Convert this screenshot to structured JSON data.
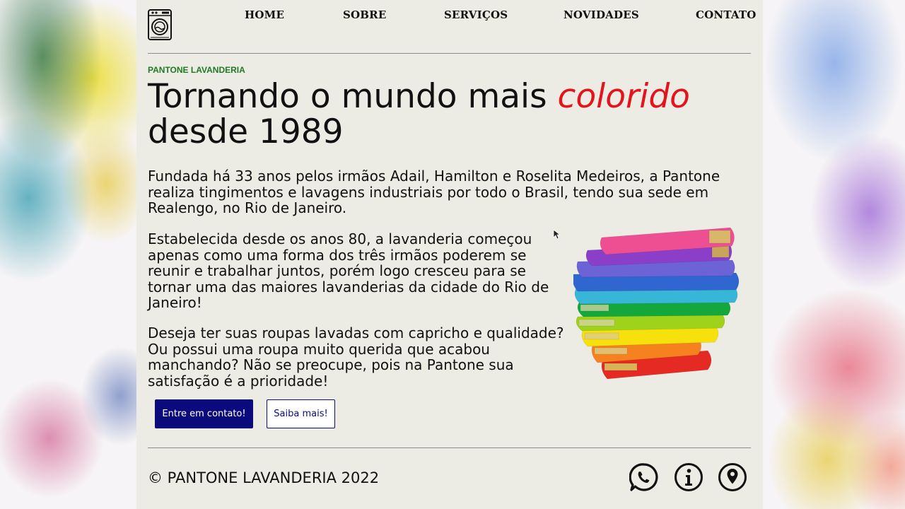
{
  "nav": {
    "home": "HOME",
    "about": "SOBRE",
    "services": "SERVIÇOS",
    "news": "NOVIDADES",
    "contact": "CONTATO"
  },
  "hero": {
    "eyebrow": "PANTONE LAVANDERIA",
    "headline_part1": "Tornando o mundo mais ",
    "headline_accent": "colorido",
    "headline_part2": "desde 1989",
    "paragraph1": "Fundada há 33 anos pelos irmãos Adail, Hamilton e Roselita Medeiros, a Pantone realiza tingimentos e lavagens industriais por todo o Brasil, tendo sua sede em Realengo, no Rio de Janeiro.",
    "paragraph2": "Estabelecida desde os anos 80, a lavanderia começou apenas como uma forma dos três irmãos poderem se reunir e trabalhar juntos, porém logo cresceu para se tornar uma das maiores lavanderias da cidade do Rio de Janeiro!",
    "paragraph3": "Deseja ter suas roupas lavadas com capricho e qualidade? Ou possui uma roupa muito querida que acabou manchando? Não se preocupe, pois na Pantone sua satisfação é a prioridade!",
    "cta_primary": "Entre em contato!",
    "cta_secondary": "Saiba mais!"
  },
  "footer": {
    "copyright": "© PANTONE LAVANDERIA 2022",
    "icons": [
      "whatsapp-icon",
      "info-icon",
      "location-pin-icon"
    ]
  },
  "colors": {
    "accent_red": "#e3141b",
    "eyebrow_green": "#1f7a23",
    "button_navy": "#0b0a7c",
    "panel_bg": "#ecebe4"
  }
}
